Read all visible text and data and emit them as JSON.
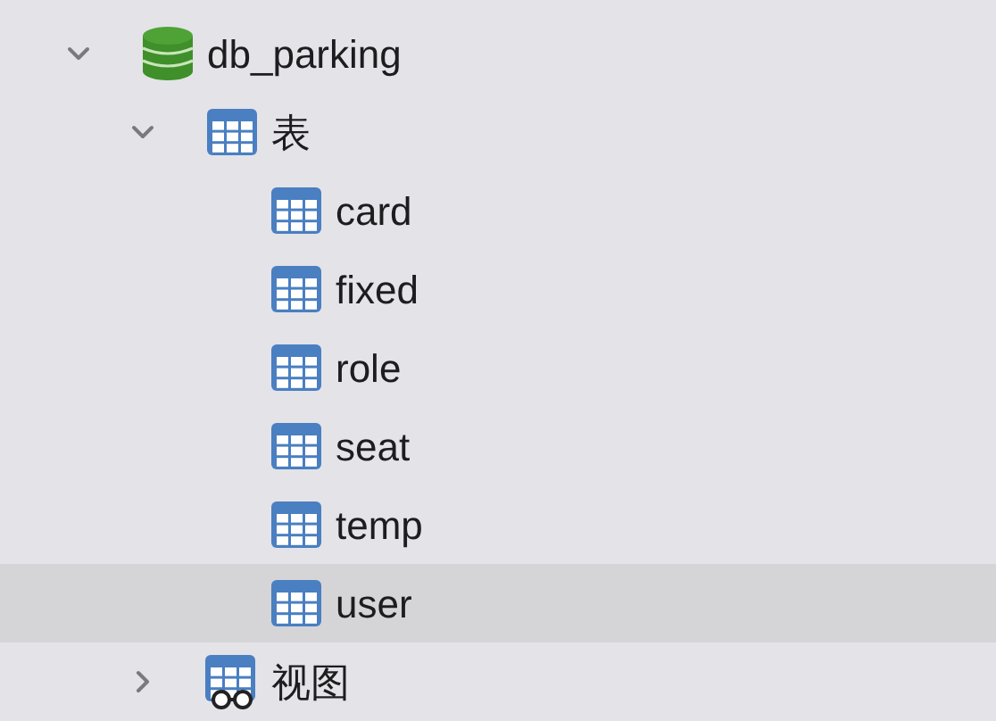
{
  "tree": [
    {
      "label": "db_parking",
      "kind": "database",
      "expanded": true,
      "selected": false,
      "children": [
        {
          "label": "表",
          "kind": "tables",
          "expanded": true,
          "selected": false,
          "children": [
            {
              "label": "card",
              "kind": "table",
              "selected": false
            },
            {
              "label": "fixed",
              "kind": "table",
              "selected": false
            },
            {
              "label": "role",
              "kind": "table",
              "selected": false
            },
            {
              "label": "seat",
              "kind": "table",
              "selected": false
            },
            {
              "label": "temp",
              "kind": "table",
              "selected": false
            },
            {
              "label": "user",
              "kind": "table",
              "selected": true
            }
          ]
        },
        {
          "label": "视图",
          "kind": "views",
          "expanded": false,
          "selected": false
        }
      ]
    }
  ]
}
